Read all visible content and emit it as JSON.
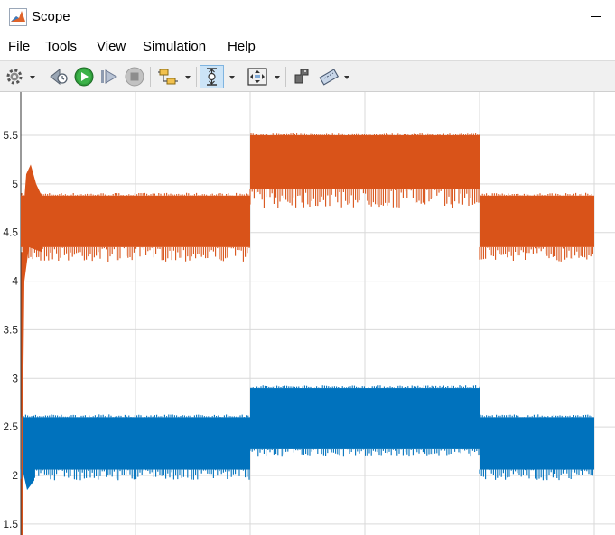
{
  "window": {
    "title": "Scope"
  },
  "menu": {
    "file": "File",
    "tools": "Tools",
    "view": "View",
    "simulation": "Simulation",
    "help": "Help"
  },
  "toolbar": {
    "icons": [
      "gear-icon",
      "dropdown-arrow-icon",
      "step-back-icon",
      "run-icon",
      "step-forward-icon",
      "stop-icon",
      "signal-selector-icon",
      "zoom-y-icon",
      "fit-to-view-icon",
      "cursor-measure-icon",
      "highlight-icon"
    ]
  },
  "colors": {
    "series1": "#D95319",
    "series2": "#0072BD",
    "grid": "#d9d9d9",
    "toolbar_bg": "#f0f0f0"
  },
  "chart_data": {
    "type": "line",
    "ylim": [
      1.4,
      5.85
    ],
    "ytick_labels": [
      "5.5",
      "5",
      "4.5",
      "4",
      "3.5",
      "3",
      "2.5",
      "2",
      "1.5"
    ],
    "grid": true,
    "series": [
      {
        "color": "#D95319",
        "segments": [
          {
            "x_start": 0.0,
            "x_end": 0.2,
            "upper": 4.88,
            "lower": 4.35,
            "min": 4.2
          },
          {
            "x_start": 0.2,
            "x_end": 0.4,
            "upper": 5.5,
            "lower": 4.95,
            "min": 4.75
          },
          {
            "x_start": 0.4,
            "x_end": 0.5,
            "upper": 4.88,
            "lower": 4.35,
            "min": 4.2
          }
        ]
      },
      {
        "color": "#0072BD",
        "segments": [
          {
            "x_start": 0.0,
            "x_end": 0.2,
            "upper": 2.6,
            "lower": 2.06,
            "min": 1.95
          },
          {
            "x_start": 0.2,
            "x_end": 0.4,
            "upper": 2.9,
            "lower": 2.27,
            "min": 2.2
          },
          {
            "x_start": 0.4,
            "x_end": 0.5,
            "upper": 2.6,
            "lower": 2.06,
            "min": 1.95
          }
        ]
      }
    ]
  }
}
